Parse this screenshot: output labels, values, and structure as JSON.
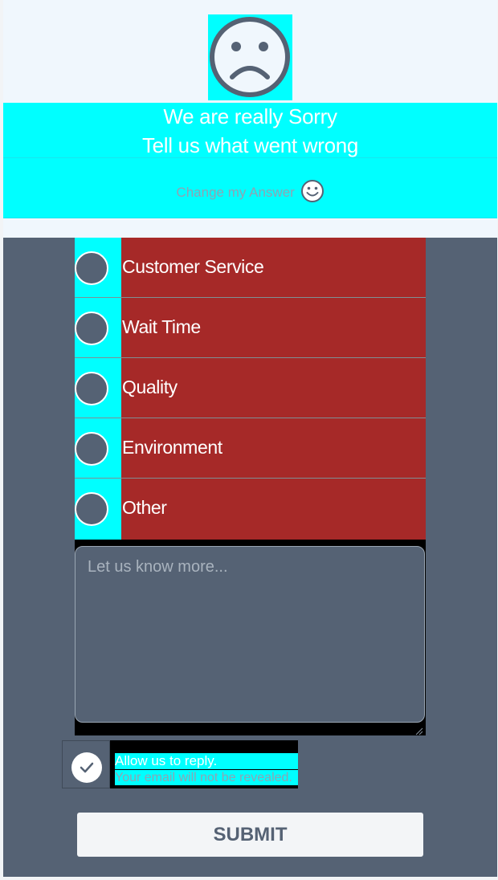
{
  "header": {
    "title": "We are really Sorry",
    "subtitle": "Tell us what went wrong",
    "change_answer": "Change my Answer",
    "icons": [
      "sad-face-icon",
      "smile-icon"
    ]
  },
  "options": [
    {
      "label": "Customer Service"
    },
    {
      "label": "Wait Time"
    },
    {
      "label": "Quality"
    },
    {
      "label": "Environment"
    },
    {
      "label": "Other"
    }
  ],
  "comment": {
    "placeholder": "Let us know more...",
    "value": ""
  },
  "reply": {
    "checked": true,
    "label": "Allow us to reply.",
    "note": "Your email will not be revealed."
  },
  "submit": {
    "label": "SUBMIT"
  },
  "colors": {
    "accent": "#00ffff",
    "option_bg": "#a62928",
    "panel_bg": "#556274",
    "header_bg": "#f0f7fd"
  }
}
